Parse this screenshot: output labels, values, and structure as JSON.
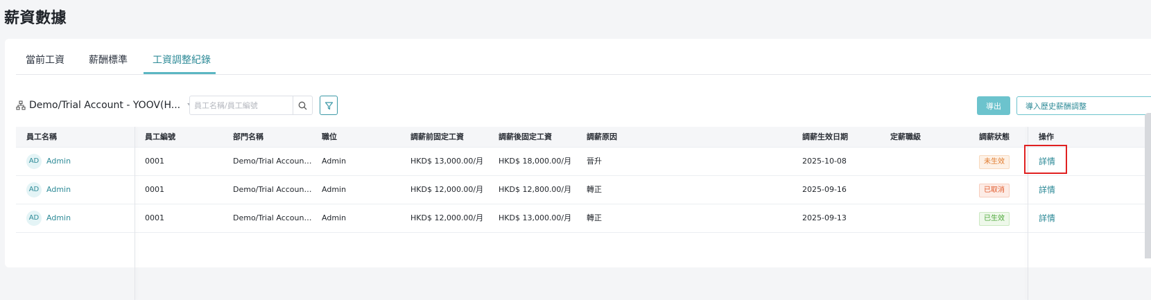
{
  "page": {
    "title": "薪資數據"
  },
  "tabs": [
    {
      "label": "當前工資"
    },
    {
      "label": "薪酬標準"
    },
    {
      "label": "工資調整紀錄"
    }
  ],
  "toolbar": {
    "org_select": "Demo/Trial Account - YOOV(H...",
    "search_placeholder": "員工名稱/員工編號",
    "export_label": "導出",
    "import_label": "導入歷史薪酬調整"
  },
  "table": {
    "headers": {
      "name": "員工名稱",
      "id": "員工編號",
      "dept": "部門名稱",
      "position": "職位",
      "before": "調薪前固定工資",
      "after": "調薪後固定工資",
      "reason": "調薪原因",
      "date": "調薪生效日期",
      "grade": "定薪職級",
      "status": "調薪狀態",
      "action": "操作"
    },
    "rows": [
      {
        "avatar": "AD",
        "name": "Admin",
        "id": "0001",
        "dept": "Demo/Trial Accoun…",
        "position": "Admin",
        "before": "HKD$ 13,000.00/月",
        "after": "HKD$ 18,000.00/月",
        "reason": "晉升",
        "date": "2025-10-08",
        "grade": "",
        "status": "未生效",
        "action": "詳情"
      },
      {
        "avatar": "AD",
        "name": "Admin",
        "id": "0001",
        "dept": "Demo/Trial Accoun…",
        "position": "Admin",
        "before": "HKD$ 12,000.00/月",
        "after": "HKD$ 12,800.00/月",
        "reason": "轉正",
        "date": "2025-09-16",
        "grade": "",
        "status": "已取消",
        "action": "詳情"
      },
      {
        "avatar": "AD",
        "name": "Admin",
        "id": "0001",
        "dept": "Demo/Trial Accoun…",
        "position": "Admin",
        "before": "HKD$ 12,000.00/月",
        "after": "HKD$ 13,000.00/月",
        "reason": "轉正",
        "date": "2025-09-13",
        "grade": "",
        "status": "已生效",
        "action": "詳情"
      }
    ]
  },
  "colors": {
    "accent": "#5bb6c2",
    "link": "#2d8a97",
    "highlight": "#e02020"
  }
}
